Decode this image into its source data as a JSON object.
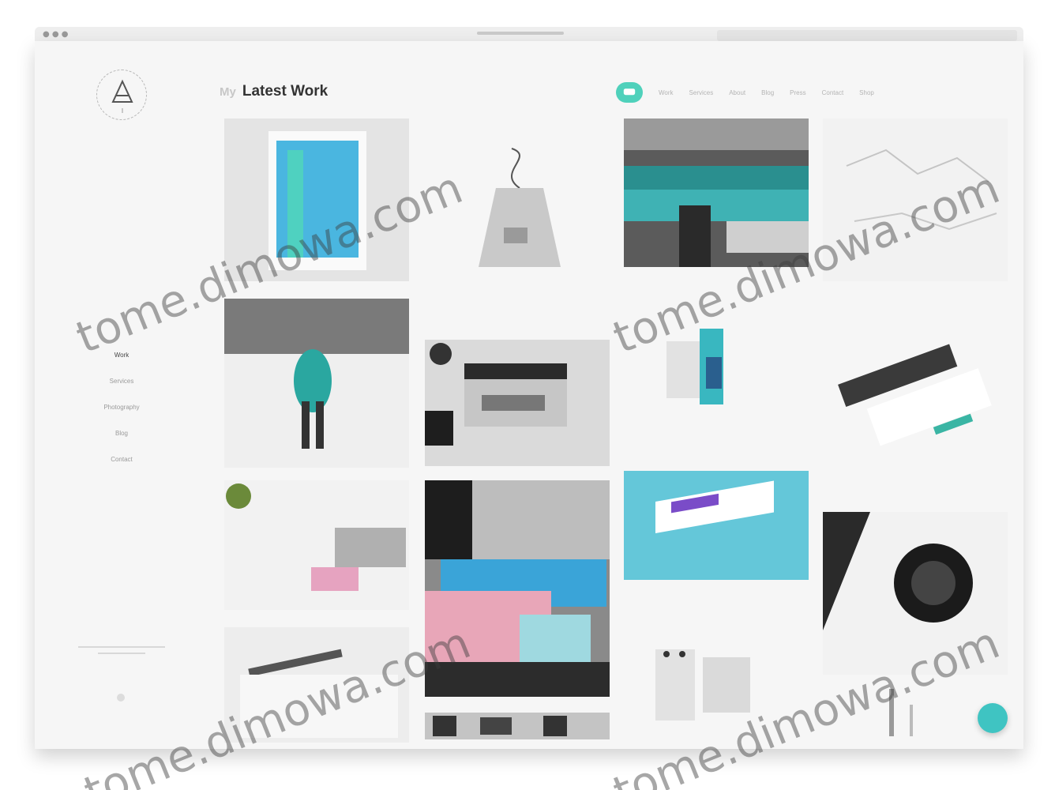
{
  "header": {
    "title_prefix": "My",
    "title": "Latest Work"
  },
  "nav": {
    "items": [
      {
        "label": "Work",
        "active": true
      },
      {
        "label": "Services",
        "active": false
      },
      {
        "label": "Photography",
        "active": false
      },
      {
        "label": "Blog",
        "active": false
      },
      {
        "label": "Contact",
        "active": false
      }
    ]
  },
  "topnav": {
    "badge_icon": "chat-icon",
    "links": [
      "Work",
      "Services",
      "About",
      "Blog",
      "Press",
      "Contact",
      "Shop"
    ]
  },
  "watermark": "tome.dimowa.com",
  "colors": {
    "accent": "#4fd1bb",
    "fab": "#3fc4c2",
    "background": "#f6f6f6"
  },
  "fab_icon": "circle-action-icon"
}
